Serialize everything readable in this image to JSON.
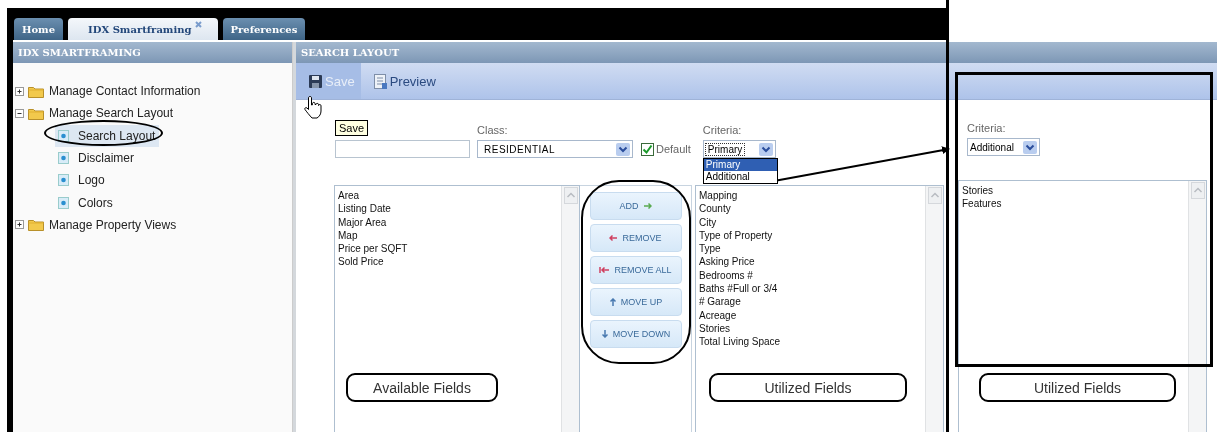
{
  "tabs": [
    {
      "label": "Home",
      "selected": false,
      "closable": false
    },
    {
      "label": "IDX Smartframing",
      "selected": true,
      "closable": true
    },
    {
      "label": "Preferences",
      "selected": false,
      "closable": false
    }
  ],
  "sidebar": {
    "title": "IDX SMARTFRAMING",
    "items": [
      {
        "label": "Manage Contact Information",
        "kind": "folder",
        "expanded": false
      },
      {
        "label": "Manage Search Layout",
        "kind": "folder",
        "expanded": true,
        "children": [
          {
            "label": "Search Layout",
            "kind": "page",
            "selected": true
          },
          {
            "label": "Disclaimer",
            "kind": "page",
            "selected": false
          },
          {
            "label": "Logo",
            "kind": "page",
            "selected": false
          },
          {
            "label": "Colors",
            "kind": "page",
            "selected": false
          }
        ]
      },
      {
        "label": "Manage Property Views",
        "kind": "folder",
        "expanded": false
      }
    ]
  },
  "main": {
    "title": "SEARCH LAYOUT",
    "toolbar": [
      {
        "label": "Save",
        "kind": "save",
        "hovered": true
      },
      {
        "label": "Preview",
        "kind": "preview",
        "hovered": false
      }
    ],
    "tooltip": "Save",
    "class": {
      "label": "Class:",
      "value": "RESIDENTIAL"
    },
    "default": {
      "label": "Default",
      "checked": true
    },
    "criteria": {
      "label": "Criteria:",
      "value": "Primary",
      "options": [
        {
          "label": "Primary",
          "selected": true
        },
        {
          "label": "Additional",
          "selected": false
        }
      ]
    },
    "available_fields": [
      "Area",
      "Listing Date",
      "Major Area",
      "Map",
      "Price per SQFT",
      "Sold Price"
    ],
    "buttons": [
      {
        "label": "ADD",
        "kind": "add"
      },
      {
        "label": "REMOVE",
        "kind": "remove"
      },
      {
        "label": "REMOVE ALL",
        "kind": "remove_all"
      },
      {
        "label": "MOVE UP",
        "kind": "up"
      },
      {
        "label": "MOVE DOWN",
        "kind": "down"
      }
    ],
    "utilized_fields": [
      "Mapping",
      "County",
      "City",
      "Type of Property",
      "Type",
      "Asking Price",
      "Bedrooms #",
      "Baths #Full or 3/4",
      "# Garage",
      "Acreage",
      "Stories",
      "Total Living Space"
    ]
  },
  "additional_view": {
    "criteria": {
      "label": "Criteria:",
      "value": "Additional"
    },
    "utilized_fields": [
      "Stories",
      "Features"
    ]
  },
  "annotations": [
    {
      "text": "Available Fields"
    },
    {
      "text": "Utilized Fields"
    },
    {
      "text": "Utilized Fields"
    }
  ]
}
